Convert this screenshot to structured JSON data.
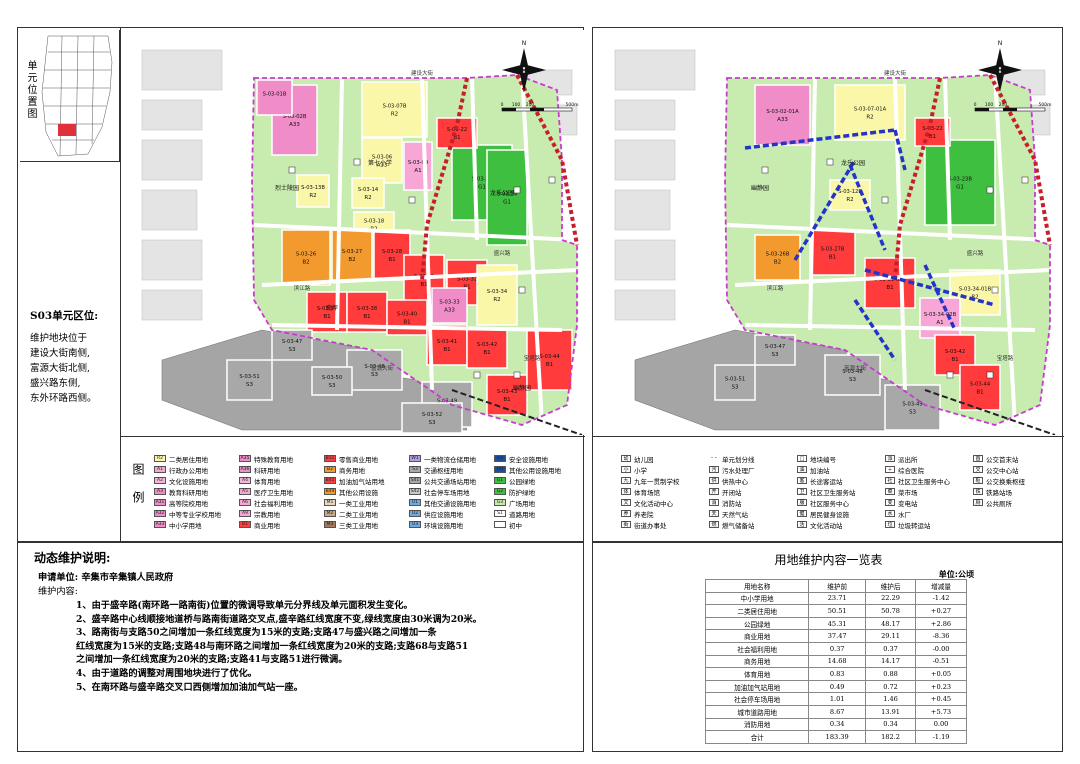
{
  "left_panel": {
    "inset_label": "单元位置图",
    "unit_title": "S03单元区位:",
    "unit_desc_lines": [
      "维护地块位于",
      "建设大街南侧,",
      "富源大街北侧,",
      "盛兴路东侧,",
      "东外环路西侧。"
    ],
    "legend_label": "图例"
  },
  "map_common": {
    "north_label": "N",
    "scale_labels": [
      "0",
      "100",
      "200",
      "500m"
    ],
    "road_labels": [
      "盛兴路",
      "建设大街",
      "富源大街",
      "滨江路",
      "宝塔路"
    ]
  },
  "left_map": {
    "parcels": [
      {
        "code": "S-03-02B",
        "type": "A33",
        "color": "#f08cc8"
      },
      {
        "code": "S-03-07B",
        "type": "R2",
        "color": "#fbf7a8"
      },
      {
        "code": "S-03-01B",
        "type": "",
        "color": "#f08cc8"
      },
      {
        "code": "S-03-06",
        "type": "A33",
        "color": "#fbf7a8"
      },
      {
        "code": "S-03-09",
        "type": "A1",
        "color": "#f7a6d6"
      },
      {
        "code": "S-03-23",
        "type": "G1",
        "color": "#3fbf3f"
      },
      {
        "code": "S-03-22",
        "type": "B1",
        "color": "#ff3b3b"
      },
      {
        "code": "S-03-13B",
        "type": "R2",
        "color": "#fbf7a8"
      },
      {
        "code": "S-03-14",
        "type": "R2",
        "color": "#fbf7a8"
      },
      {
        "code": "S-03-18",
        "type": "R2",
        "color": "#fbf7a8"
      },
      {
        "code": "S-03-24",
        "type": "G1",
        "color": "#3fbf3f"
      },
      {
        "code": "S-03-26",
        "type": "B2",
        "color": "#f39a2f"
      },
      {
        "code": "S-03-27",
        "type": "B2",
        "color": "#f39a2f"
      },
      {
        "code": "S-03-28",
        "type": "B1",
        "color": "#ff3b3b"
      },
      {
        "code": "S-03-31",
        "type": "B1",
        "color": "#ff3b3b"
      },
      {
        "code": "S-03-32",
        "type": "B1",
        "color": "#ff3b3b"
      },
      {
        "code": "S-03-34",
        "type": "R2",
        "color": "#fbf7a8"
      },
      {
        "code": "S-03-33",
        "type": "A33",
        "color": "#f08cc8"
      },
      {
        "code": "S-03-37",
        "type": "B1",
        "color": "#ff3b3b"
      },
      {
        "code": "S-03-38",
        "type": "B1",
        "color": "#ff3b3b"
      },
      {
        "code": "S-03-40",
        "type": "B1",
        "color": "#ff3b3b"
      },
      {
        "code": "S-03-41",
        "type": "B1",
        "color": "#ff3b3b"
      },
      {
        "code": "S-03-42",
        "type": "B1",
        "color": "#ff3b3b"
      },
      {
        "code": "S-03-43",
        "type": "B1",
        "color": "#ff3b3b"
      },
      {
        "code": "S-03-44",
        "type": "B1",
        "color": "#ff3b3b"
      },
      {
        "code": "S-03-47",
        "type": "S3",
        "color": "#a8a8a8"
      },
      {
        "code": "S-03-48",
        "type": "S3",
        "color": "#a8a8a8"
      },
      {
        "code": "S-03-49",
        "type": "S3",
        "color": "#a8a8a8"
      },
      {
        "code": "S-03-51",
        "type": "S3",
        "color": "#a8a8a8"
      },
      {
        "code": "S-03-52",
        "type": "S3",
        "color": "#a8a8a8"
      },
      {
        "code": "S-03-50",
        "type": "S3",
        "color": "#a8a8a8"
      }
    ],
    "place_labels": [
      "第七小学",
      "烈士陵园",
      "龙乐公园",
      "南岸",
      "幽静园"
    ]
  },
  "right_map": {
    "parcels": [
      {
        "code": "S-03-02-01A",
        "type": "A33",
        "color": "#f08cc8"
      },
      {
        "code": "S-03-07-01A",
        "type": "R2",
        "color": "#fbf7a8"
      },
      {
        "code": "S-03-23B",
        "type": "G1",
        "color": "#3fbf3f"
      },
      {
        "code": "S-03-22",
        "type": "B1",
        "color": "#ff3b3b"
      },
      {
        "code": "S-03-12B",
        "type": "R2",
        "color": "#fbf7a8"
      },
      {
        "code": "S-03-26B",
        "type": "B2",
        "color": "#f39a2f"
      },
      {
        "code": "S-03-27B",
        "type": "B1",
        "color": "#ff3b3b"
      },
      {
        "code": "S-03-31-01B",
        "type": "B1",
        "color": "#ff3b3b"
      },
      {
        "code": "S-03-34-01B",
        "type": "R2",
        "color": "#fbf7a8"
      },
      {
        "code": "S-03-34-02B",
        "type": "A1",
        "color": "#f7a6d6"
      },
      {
        "code": "S-03-42",
        "type": "B1",
        "color": "#ff3b3b"
      },
      {
        "code": "S-03-44",
        "type": "B1",
        "color": "#ff3b3b"
      },
      {
        "code": "S-03-47",
        "type": "S3",
        "color": "#a8a8a8"
      },
      {
        "code": "S-03-48",
        "type": "S3",
        "color": "#a8a8a8"
      },
      {
        "code": "S-03-49",
        "type": "S3",
        "color": "#a8a8a8"
      },
      {
        "code": "S-03-51",
        "type": "S3",
        "color": "#a8a8a8"
      }
    ],
    "place_labels": [
      "龙乐公园",
      "幽静园"
    ]
  },
  "landuse_legend": [
    {
      "code": "R2",
      "label": "二类居住用地",
      "color": "#fbf7a8"
    },
    {
      "code": "A1",
      "label": "行政办公用地",
      "color": "#f7a6d6"
    },
    {
      "code": "A2",
      "label": "文化设施用地",
      "color": "#f5b6d9"
    },
    {
      "code": "A3",
      "label": "教育科研用地",
      "color": "#f08cc8"
    },
    {
      "code": "A31",
      "label": "高等院校用地",
      "color": "#f08cc8"
    },
    {
      "code": "A32",
      "label": "中等专业学校用地",
      "color": "#f08cc8"
    },
    {
      "code": "A33",
      "label": "中小学用地",
      "color": "#f08cc8"
    },
    {
      "code": "A35",
      "label": "特殊教育用地",
      "color": "#f08cc8"
    },
    {
      "code": "A36",
      "label": "科研用地",
      "color": "#f08cc8"
    },
    {
      "code": "A4",
      "label": "体育用地",
      "color": "#f5b6d9"
    },
    {
      "code": "A5",
      "label": "医疗卫生用地",
      "color": "#f7a6d6"
    },
    {
      "code": "A6",
      "label": "社会福利用地",
      "color": "#f7a6d6"
    },
    {
      "code": "A9",
      "label": "宗教用地",
      "color": "#f7a6d6"
    },
    {
      "code": "B1",
      "label": "商业用地",
      "color": "#ff3b3b"
    },
    {
      "code": "B11",
      "label": "零售商业用地",
      "color": "#ff3b3b"
    },
    {
      "code": "B2",
      "label": "商务用地",
      "color": "#f39a2f"
    },
    {
      "code": "B41",
      "label": "加油加气站用地",
      "color": "#ff3b3b"
    },
    {
      "code": "B49",
      "label": "其他公用设施",
      "color": "#f39a2f"
    },
    {
      "code": "M1",
      "label": "一类工业用地",
      "color": "#e8d7c0"
    },
    {
      "code": "M2",
      "label": "二类工业用地",
      "color": "#c9a884"
    },
    {
      "code": "M3",
      "label": "三类工业用地",
      "color": "#a0785a"
    },
    {
      "code": "W1",
      "label": "一类物流仓储用地",
      "color": "#b39ddb"
    },
    {
      "code": "S3",
      "label": "交通枢纽用地",
      "color": "#a8a8a8"
    },
    {
      "code": "S41",
      "label": "公共交通场站用地",
      "color": "#a8a8a8"
    },
    {
      "code": "S42",
      "label": "社会停车场用地",
      "color": "#c8c8c8"
    },
    {
      "code": "U1",
      "label": "其他交通设施用地",
      "color": "#6fa8dc"
    },
    {
      "code": "U2",
      "label": "供应设施用地",
      "color": "#6fa8dc"
    },
    {
      "code": "U3",
      "label": "环境设施用地",
      "color": "#6fa8dc"
    },
    {
      "code": "U4",
      "label": "安全设施用地",
      "color": "#1f4e9c"
    },
    {
      "code": "U9",
      "label": "其他公用设施用地",
      "color": "#1f4e9c"
    },
    {
      "code": "G1",
      "label": "公园绿地",
      "color": "#3fbf3f"
    },
    {
      "code": "G2",
      "label": "防护绿地",
      "color": "#3fbf3f"
    },
    {
      "code": "G3",
      "label": "广场用地",
      "color": "#c6e9a8"
    },
    {
      "code": "S1",
      "label": "道路用地",
      "color": "#ffffff"
    },
    {
      "code": "",
      "label": "初中",
      "color": "#ffffff"
    }
  ],
  "symbol_legend": [
    {
      "icon": "幼",
      "label": "幼儿园"
    },
    {
      "icon": "小",
      "label": "小学"
    },
    {
      "icon": "九",
      "label": "九年一贯制学校"
    },
    {
      "icon": "体",
      "label": "体育场馆"
    },
    {
      "icon": "文",
      "label": "文化活动中心"
    },
    {
      "icon": "养",
      "label": "养老院"
    },
    {
      "icon": "街",
      "label": "街道办事处"
    },
    {
      "icon": "- -",
      "label": "单元划分线"
    },
    {
      "icon": "污",
      "label": "污水处理厂"
    },
    {
      "icon": "供",
      "label": "供热中心"
    },
    {
      "icon": "开",
      "label": "开闭站"
    },
    {
      "icon": "消",
      "label": "消防站"
    },
    {
      "icon": "天",
      "label": "天然气站"
    },
    {
      "icon": "燃",
      "label": "燃气储备站"
    },
    {
      "icon": "□",
      "label": "地块编号"
    },
    {
      "icon": "油",
      "label": "加油站"
    },
    {
      "icon": "客",
      "label": "长途客运站"
    },
    {
      "icon": "卫",
      "label": "社区卫生服务站"
    },
    {
      "icon": "服",
      "label": "社区服务中心"
    },
    {
      "icon": "健",
      "label": "居民健身设施"
    },
    {
      "icon": "活",
      "label": "文化活动站"
    },
    {
      "icon": "派",
      "label": "派出所"
    },
    {
      "icon": "+",
      "label": "综合医院"
    },
    {
      "icon": "社",
      "label": "社区卫生服务中心"
    },
    {
      "icon": "菜",
      "label": "菜市场"
    },
    {
      "icon": "变",
      "label": "变电站"
    },
    {
      "icon": "水",
      "label": "水厂"
    },
    {
      "icon": "垃",
      "label": "垃圾转运站"
    },
    {
      "icon": "首",
      "label": "公交首末站"
    },
    {
      "icon": "交",
      "label": "公交中心站"
    },
    {
      "icon": "枢",
      "label": "公交换乘枢纽"
    },
    {
      "icon": "铁",
      "label": "铁路站场"
    },
    {
      "icon": "厕",
      "label": "公共厕所"
    }
  ],
  "notes": {
    "title": "动态维护说明:",
    "applicant": "申请单位: 辛集市辛集镇人民政府",
    "content_label": "维护内容:",
    "lines": [
      "1、由于盛辛路(南环路一路南街)位置的微调导致单元分界线及单元面积发生变化。",
      "2、盛辛路中心线顺接地道桥与路南街道路交叉点,盛辛路红线宽度不变,绿线宽度由30米调为20米。",
      "3、路南街与支路50之间增加一条红线宽度为15米的支路;支路47与盛兴路之间增加一条",
      "    红线宽度为15米的支路;支路48与南环路之间增加一条红线宽度为20米的支路;支路68与支路51",
      "    之间增加一条红线宽度为20米的支路;支路41与支路51进行微调。",
      "4、由于道路的调整对周围地块进行了优化。",
      "5、在南环路与盛辛路交叉口西侧增加加油加气站一座。"
    ]
  },
  "table": {
    "title": "用地维护内容一览表",
    "unit": "单位:公顷",
    "headers": [
      "用地名称",
      "维护前",
      "维护后",
      "增减量"
    ],
    "rows": [
      [
        "中小学用地",
        "23.71",
        "22.29",
        "-1.42"
      ],
      [
        "二类居住用地",
        "50.51",
        "50.78",
        "+0.27"
      ],
      [
        "公园绿地",
        "45.31",
        "48.17",
        "+2.86"
      ],
      [
        "商业用地",
        "37.47",
        "29.11",
        "-8.36"
      ],
      [
        "社会福利用地",
        "0.37",
        "0.37",
        "-0.00"
      ],
      [
        "商务用地",
        "14.68",
        "14.17",
        "-0.51"
      ],
      [
        "体育用地",
        "0.83",
        "0.88",
        "+0.05"
      ],
      [
        "加油加气站用地",
        "0.49",
        "0.72",
        "+0.23"
      ],
      [
        "社会停车场用地",
        "1.01",
        "1.46",
        "+0.45"
      ],
      [
        "城市道路用地",
        "8.67",
        "13.91",
        "+5.73"
      ],
      [
        "消防用地",
        "0.34",
        "0.34",
        "0.00"
      ],
      [
        "合计",
        "183.39",
        "182.2",
        "-1.19"
      ]
    ]
  }
}
